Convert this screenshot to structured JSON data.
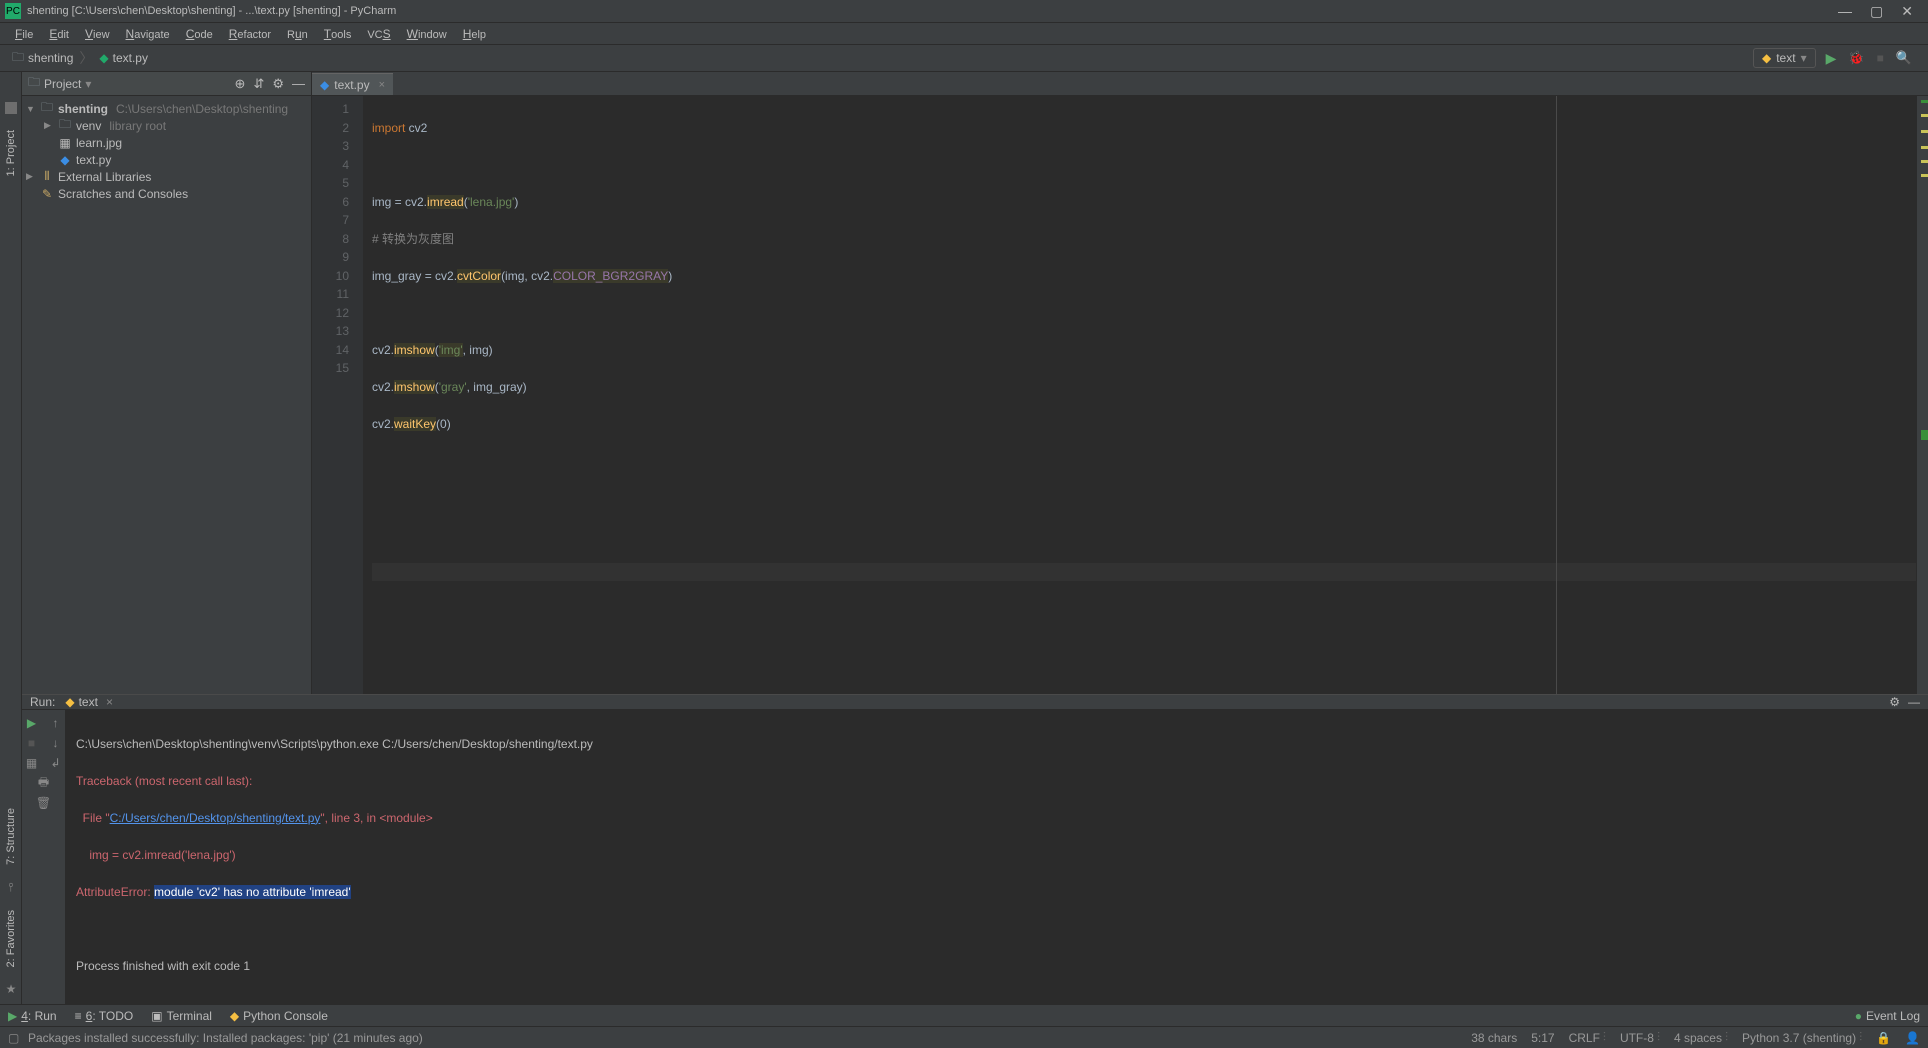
{
  "window": {
    "title": "shenting [C:\\Users\\chen\\Desktop\\shenting] - ...\\text.py [shenting] - PyCharm"
  },
  "menu": {
    "file": "File",
    "edit": "Edit",
    "view": "View",
    "navigate": "Navigate",
    "code": "Code",
    "refactor": "Refactor",
    "run": "Run",
    "tools": "Tools",
    "vcs": "VCS",
    "window": "Window",
    "help": "Help"
  },
  "breadcrumb": {
    "root": "shenting",
    "file": "text.py"
  },
  "run_config": "text",
  "project": {
    "title": "Project",
    "root": {
      "name": "shenting",
      "path": "C:\\Users\\chen\\Desktop\\shenting"
    },
    "venv": {
      "name": "venv",
      "note": "library root"
    },
    "files": {
      "learn": "learn.jpg",
      "text": "text.py"
    },
    "ext_lib": "External Libraries",
    "scratches": "Scratches and Consoles"
  },
  "tab": {
    "name": "text.py"
  },
  "gutter_lines": [
    "1",
    "2",
    "3",
    "4",
    "5",
    "6",
    "7",
    "8",
    "9",
    "10",
    "11",
    "12",
    "13",
    "14",
    "15"
  ],
  "code": {
    "l1_a": "import",
    "l1_b": " cv2",
    "l3_a": "img = cv2.",
    "l3_b": "imread",
    "l3_c": "(",
    "l3_d": "'lena.jpg'",
    "l3_e": ")",
    "l4": "# 转换为灰度图",
    "l5_a": "img_gray = cv2.",
    "l5_b": "cvtColor",
    "l5_c": "(img, cv2.",
    "l5_d": "COLOR_BGR2GRAY",
    "l5_e": ")",
    "l7_a": "cv2.",
    "l7_b": "imshow",
    "l7_c": "(",
    "l7_d": "'img'",
    "l7_e": ", img)",
    "l8_a": "cv2.",
    "l8_b": "imshow",
    "l8_c": "(",
    "l8_d": "'gray'",
    "l8_e": ", img_gray)",
    "l9_a": "cv2.",
    "l9_b": "waitKey",
    "l9_c": "(",
    "l9_d": "0",
    "l9_e": ")"
  },
  "run_panel": {
    "label": "Run:",
    "tab": "text",
    "console": {
      "cmd": "C:\\Users\\chen\\Desktop\\shenting\\venv\\Scripts\\python.exe C:/Users/chen/Desktop/shenting/text.py",
      "tb1": "Traceback (most recent call last):",
      "tb2a": "  File \"",
      "tb2_link": "C:/Users/chen/Desktop/shenting/text.py",
      "tb2b": "\", line 3, in <module>",
      "tb3": "    img = cv2.imread('lena.jpg')",
      "err_a": "AttributeError: ",
      "err_sel": "module 'cv2' has no attribute 'imread'",
      "exit": "Process finished with exit code 1"
    }
  },
  "bottom_tabs": {
    "run": "4: Run",
    "todo": "6: TODO",
    "terminal": "Terminal",
    "pyconsole": "Python Console",
    "eventlog": "Event Log"
  },
  "status": {
    "msg": "Packages installed successfully: Installed packages: 'pip' (21 minutes ago)",
    "chars": "38 chars",
    "pos": "5:17",
    "crlf": "CRLF",
    "enc": "UTF-8",
    "indent": "4 spaces",
    "interp": "Python 3.7 (shenting)"
  },
  "leftbar": {
    "project": "1: Project",
    "structure": "7: Structure",
    "favorites": "2: Favorites"
  }
}
